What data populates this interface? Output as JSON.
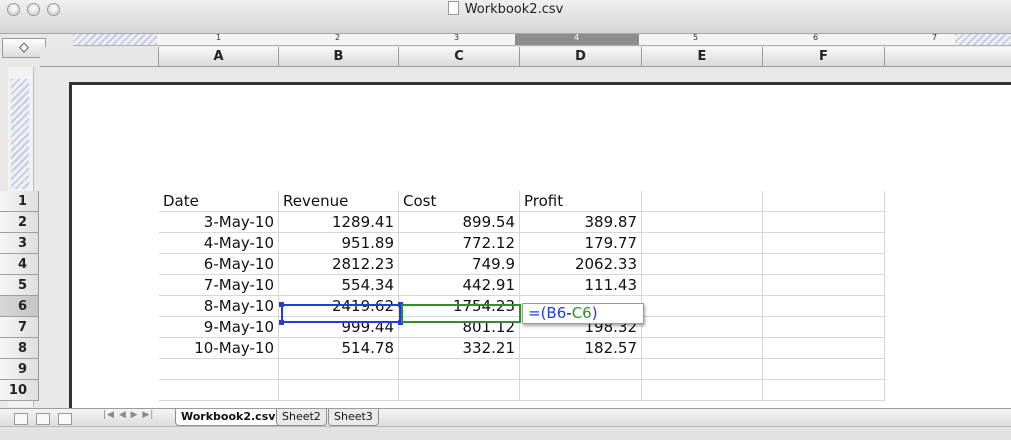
{
  "window": {
    "title": "Workbook2.csv"
  },
  "toolbar": {
    "toggle_icon": "◇"
  },
  "ruler": {
    "numbers": [
      "1",
      "2",
      "3",
      "4",
      "5",
      "6",
      "7"
    ]
  },
  "columns": [
    "A",
    "B",
    "C",
    "D",
    "E",
    "F"
  ],
  "rows": [
    "1",
    "2",
    "3",
    "4",
    "5",
    "6",
    "7",
    "8",
    "9",
    "10"
  ],
  "selected_row": "6",
  "table": {
    "headers": [
      "Date",
      "Revenue",
      "Cost",
      "Profit"
    ],
    "rows": [
      [
        "3-May-10",
        "1289.41",
        "899.54",
        "389.87"
      ],
      [
        "4-May-10",
        "951.89",
        "772.12",
        "179.77"
      ],
      [
        "6-May-10",
        "2812.23",
        "749.9",
        "2062.33"
      ],
      [
        "7-May-10",
        "554.34",
        "442.91",
        "111.43"
      ],
      [
        "8-May-10",
        "2419.62",
        "1754.23",
        ""
      ],
      [
        "9-May-10",
        "999.44",
        "801.12",
        "198.32"
      ],
      [
        "10-May-10",
        "514.78",
        "332.21",
        "182.57"
      ]
    ]
  },
  "formula": {
    "open": "=(",
    "ref1": "B6",
    "op": "-",
    "ref2": "C6",
    "close": ")",
    "ref1_color": "#1f3fd6",
    "ref2_color": "#2f8f2f"
  },
  "tabs": {
    "nav": "|◀ ◀ ▶ ▶|",
    "sheets": [
      "Workbook2.csv",
      "Sheet2",
      "Sheet3"
    ],
    "active": "Workbook2.csv"
  }
}
